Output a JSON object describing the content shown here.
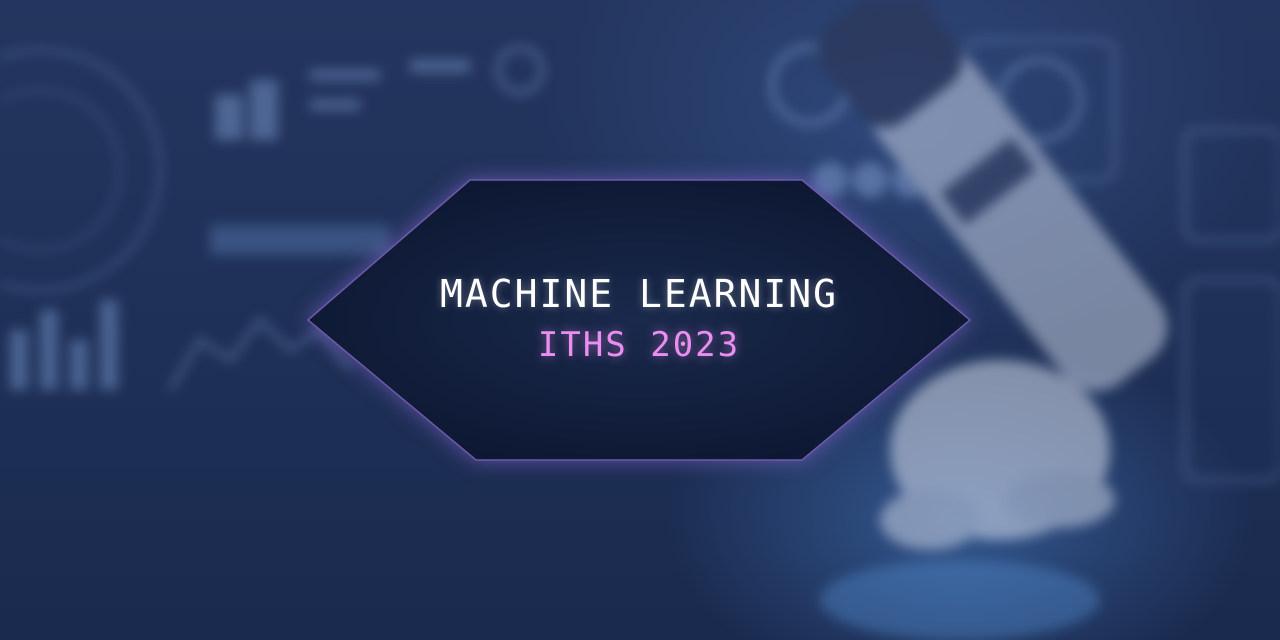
{
  "banner": {
    "title": "MACHINE LEARNING",
    "subtitle": "ITHS 2023"
  },
  "colors": {
    "background": "#1f3158",
    "panel": "#0f1a33",
    "title": "#ffffff",
    "subtitle": "#ea8ef0",
    "glow": "#9a70e6"
  },
  "icons": {
    "background": "blurred-robot-arm-dashboard-illustration"
  }
}
